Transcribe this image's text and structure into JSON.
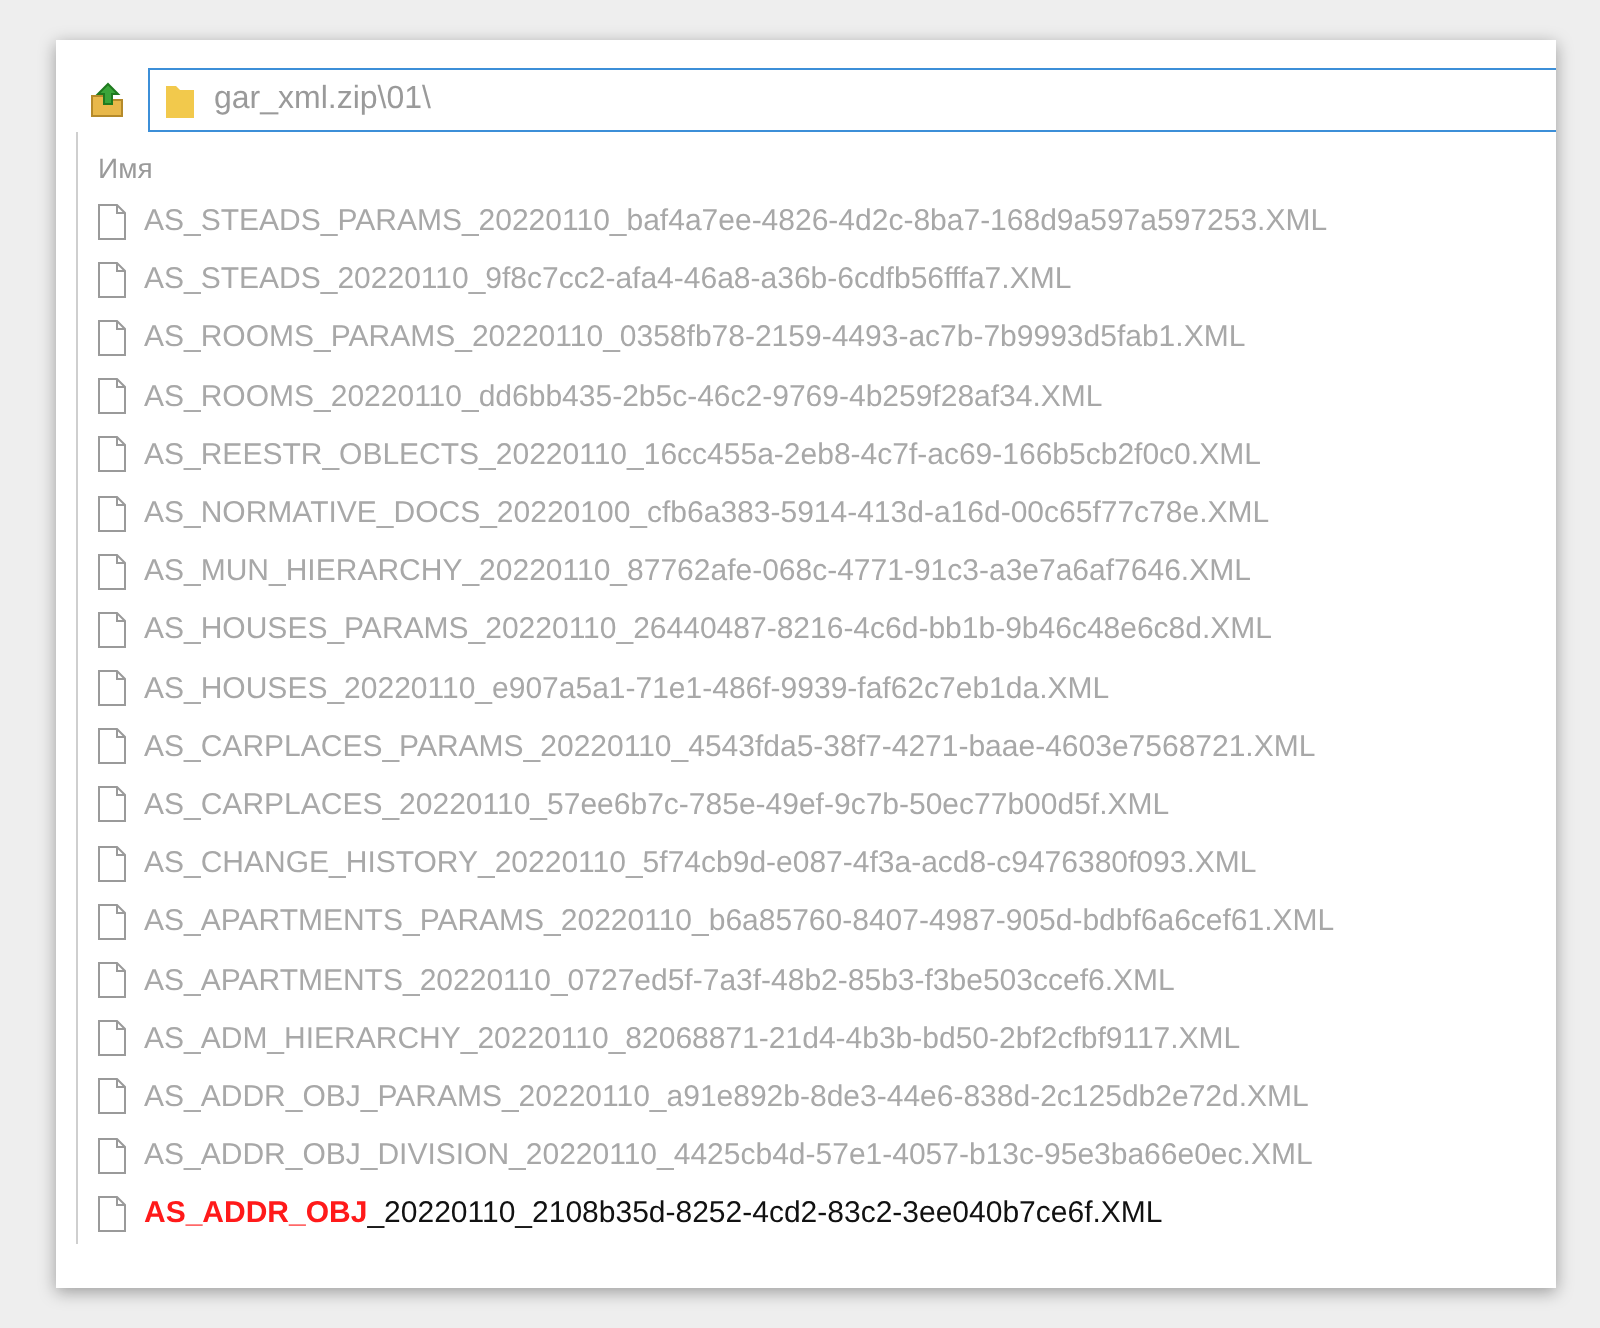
{
  "address_bar": {
    "path": "gar_xml.zip\\01\\"
  },
  "list": {
    "column_header": "Имя",
    "files": [
      {
        "name": "AS_STEADS_PARAMS_20220110_baf4a7ee-4826-4d2c-8ba7-168d9a597a597253.XML",
        "dimmed": true
      },
      {
        "name": "AS_STEADS_20220110_9f8c7cc2-afa4-46a8-a36b-6cdfb56fffa7.XML",
        "dimmed": true
      },
      {
        "name": "AS_ROOMS_PARAMS_20220110_0358fb78-2159-4493-ac7b-7b9993d5fab1.XML",
        "dimmed": true
      },
      {
        "name": "AS_ROOMS_20220110_dd6bb435-2b5c-46c2-9769-4b259f28af34.XML",
        "dimmed": true
      },
      {
        "name": "AS_REESTR_OBLECTS_20220110_16cc455a-2eb8-4c7f-ac69-166b5cb2f0c0.XML",
        "dimmed": true
      },
      {
        "name": "AS_NORMATIVE_DOCS_20220100_cfb6a383-5914-413d-a16d-00c65f77c78e.XML",
        "dimmed": true
      },
      {
        "name": "AS_MUN_HIERARCHY_20220110_87762afe-068c-4771-91c3-a3e7a6af7646.XML",
        "dimmed": true
      },
      {
        "name": "AS_HOUSES_PARAMS_20220110_26440487-8216-4c6d-bb1b-9b46c48e6c8d.XML",
        "dimmed": true
      },
      {
        "name": "AS_HOUSES_20220110_e907a5a1-71e1-486f-9939-faf62c7eb1da.XML",
        "dimmed": true
      },
      {
        "name": "AS_CARPLACES_PARAMS_20220110_4543fda5-38f7-4271-baae-4603e7568721.XML",
        "dimmed": true
      },
      {
        "name": "AS_CARPLACES_20220110_57ee6b7c-785e-49ef-9c7b-50ec77b00d5f.XML",
        "dimmed": true
      },
      {
        "name": "AS_CHANGE_HISTORY_20220110_5f74cb9d-e087-4f3a-acd8-c9476380f093.XML",
        "dimmed": true
      },
      {
        "name": "AS_APARTMENTS_PARAMS_20220110_b6a85760-8407-4987-905d-bdbf6a6cef61.XML",
        "dimmed": true
      },
      {
        "name": "AS_APARTMENTS_20220110_0727ed5f-7a3f-48b2-85b3-f3be503ccef6.XML",
        "dimmed": true
      },
      {
        "name": "AS_ADM_HIERARCHY_20220110_82068871-21d4-4b3b-bd50-2bf2cfbf9117.XML",
        "dimmed": true
      },
      {
        "name": "AS_ADDR_OBJ_PARAMS_20220110_a91e892b-8de3-44e6-838d-2c125db2e72d.XML",
        "dimmed": true
      },
      {
        "name": "AS_ADDR_OBJ_DIVISION_20220110_4425cb4d-57e1-4057-b13c-95e3ba66e0ec.XML",
        "dimmed": true
      },
      {
        "name": "**AS_ADDR_OBJ**_20220110_2108b35d-8252-4cd2-83c2-3ee040b7ce6f.XML",
        "dimmed": false
      }
    ]
  }
}
